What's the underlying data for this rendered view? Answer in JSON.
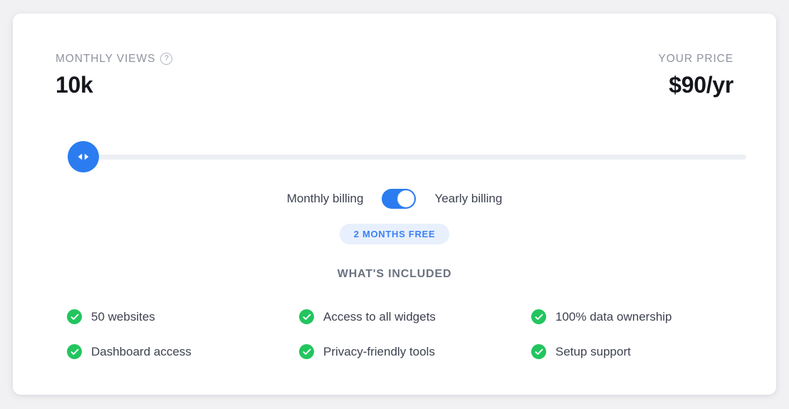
{
  "card": {
    "metrics": {
      "views_label": "MONTHLY VIEWS",
      "views_help_icon": "question-mark-icon",
      "views_value": "10k",
      "price_label": "YOUR PRICE",
      "price_value": "$90/yr"
    },
    "slider": {
      "handle_icon": "left-right-arrows-icon",
      "handle_position_percent": 0,
      "accent_color": "#2b7cf0",
      "track_color": "#eceff4"
    },
    "billing": {
      "monthly_label": "Monthly billing",
      "yearly_label": "Yearly billing",
      "toggle_state": "yearly",
      "toggle_color": "#2b7cf0",
      "badge_label": "2 MONTHS FREE",
      "badge_bg": "#e8f0fd",
      "badge_color": "#3b82f6"
    },
    "included": {
      "heading": "WHAT'S INCLUDED",
      "check_color": "#22c55e",
      "items": [
        {
          "label": "50 websites"
        },
        {
          "label": "Access to all widgets"
        },
        {
          "label": "100% data ownership"
        },
        {
          "label": "Dashboard access"
        },
        {
          "label": "Privacy-friendly tools"
        },
        {
          "label": "Setup support"
        }
      ]
    }
  }
}
